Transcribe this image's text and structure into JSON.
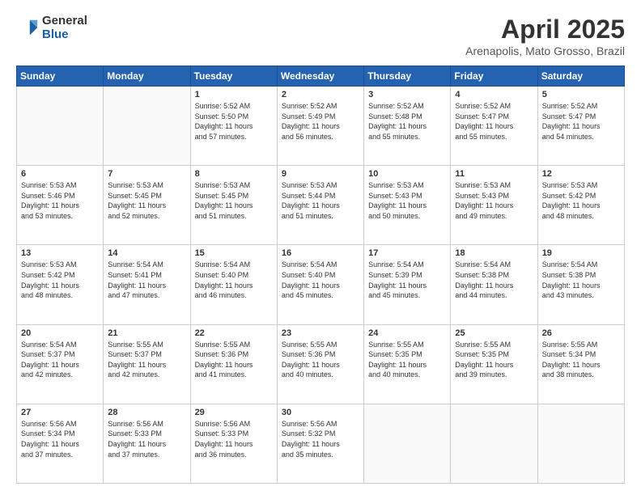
{
  "header": {
    "logo_general": "General",
    "logo_blue": "Blue",
    "title": "April 2025",
    "subtitle": "Arenapolis, Mato Grosso, Brazil"
  },
  "weekdays": [
    "Sunday",
    "Monday",
    "Tuesday",
    "Wednesday",
    "Thursday",
    "Friday",
    "Saturday"
  ],
  "weeks": [
    [
      {
        "day": "",
        "info": ""
      },
      {
        "day": "",
        "info": ""
      },
      {
        "day": "1",
        "info": "Sunrise: 5:52 AM\nSunset: 5:50 PM\nDaylight: 11 hours\nand 57 minutes."
      },
      {
        "day": "2",
        "info": "Sunrise: 5:52 AM\nSunset: 5:49 PM\nDaylight: 11 hours\nand 56 minutes."
      },
      {
        "day": "3",
        "info": "Sunrise: 5:52 AM\nSunset: 5:48 PM\nDaylight: 11 hours\nand 55 minutes."
      },
      {
        "day": "4",
        "info": "Sunrise: 5:52 AM\nSunset: 5:47 PM\nDaylight: 11 hours\nand 55 minutes."
      },
      {
        "day": "5",
        "info": "Sunrise: 5:52 AM\nSunset: 5:47 PM\nDaylight: 11 hours\nand 54 minutes."
      }
    ],
    [
      {
        "day": "6",
        "info": "Sunrise: 5:53 AM\nSunset: 5:46 PM\nDaylight: 11 hours\nand 53 minutes."
      },
      {
        "day": "7",
        "info": "Sunrise: 5:53 AM\nSunset: 5:45 PM\nDaylight: 11 hours\nand 52 minutes."
      },
      {
        "day": "8",
        "info": "Sunrise: 5:53 AM\nSunset: 5:45 PM\nDaylight: 11 hours\nand 51 minutes."
      },
      {
        "day": "9",
        "info": "Sunrise: 5:53 AM\nSunset: 5:44 PM\nDaylight: 11 hours\nand 51 minutes."
      },
      {
        "day": "10",
        "info": "Sunrise: 5:53 AM\nSunset: 5:43 PM\nDaylight: 11 hours\nand 50 minutes."
      },
      {
        "day": "11",
        "info": "Sunrise: 5:53 AM\nSunset: 5:43 PM\nDaylight: 11 hours\nand 49 minutes."
      },
      {
        "day": "12",
        "info": "Sunrise: 5:53 AM\nSunset: 5:42 PM\nDaylight: 11 hours\nand 48 minutes."
      }
    ],
    [
      {
        "day": "13",
        "info": "Sunrise: 5:53 AM\nSunset: 5:42 PM\nDaylight: 11 hours\nand 48 minutes."
      },
      {
        "day": "14",
        "info": "Sunrise: 5:54 AM\nSunset: 5:41 PM\nDaylight: 11 hours\nand 47 minutes."
      },
      {
        "day": "15",
        "info": "Sunrise: 5:54 AM\nSunset: 5:40 PM\nDaylight: 11 hours\nand 46 minutes."
      },
      {
        "day": "16",
        "info": "Sunrise: 5:54 AM\nSunset: 5:40 PM\nDaylight: 11 hours\nand 45 minutes."
      },
      {
        "day": "17",
        "info": "Sunrise: 5:54 AM\nSunset: 5:39 PM\nDaylight: 11 hours\nand 45 minutes."
      },
      {
        "day": "18",
        "info": "Sunrise: 5:54 AM\nSunset: 5:38 PM\nDaylight: 11 hours\nand 44 minutes."
      },
      {
        "day": "19",
        "info": "Sunrise: 5:54 AM\nSunset: 5:38 PM\nDaylight: 11 hours\nand 43 minutes."
      }
    ],
    [
      {
        "day": "20",
        "info": "Sunrise: 5:54 AM\nSunset: 5:37 PM\nDaylight: 11 hours\nand 42 minutes."
      },
      {
        "day": "21",
        "info": "Sunrise: 5:55 AM\nSunset: 5:37 PM\nDaylight: 11 hours\nand 42 minutes."
      },
      {
        "day": "22",
        "info": "Sunrise: 5:55 AM\nSunset: 5:36 PM\nDaylight: 11 hours\nand 41 minutes."
      },
      {
        "day": "23",
        "info": "Sunrise: 5:55 AM\nSunset: 5:36 PM\nDaylight: 11 hours\nand 40 minutes."
      },
      {
        "day": "24",
        "info": "Sunrise: 5:55 AM\nSunset: 5:35 PM\nDaylight: 11 hours\nand 40 minutes."
      },
      {
        "day": "25",
        "info": "Sunrise: 5:55 AM\nSunset: 5:35 PM\nDaylight: 11 hours\nand 39 minutes."
      },
      {
        "day": "26",
        "info": "Sunrise: 5:55 AM\nSunset: 5:34 PM\nDaylight: 11 hours\nand 38 minutes."
      }
    ],
    [
      {
        "day": "27",
        "info": "Sunrise: 5:56 AM\nSunset: 5:34 PM\nDaylight: 11 hours\nand 37 minutes."
      },
      {
        "day": "28",
        "info": "Sunrise: 5:56 AM\nSunset: 5:33 PM\nDaylight: 11 hours\nand 37 minutes."
      },
      {
        "day": "29",
        "info": "Sunrise: 5:56 AM\nSunset: 5:33 PM\nDaylight: 11 hours\nand 36 minutes."
      },
      {
        "day": "30",
        "info": "Sunrise: 5:56 AM\nSunset: 5:32 PM\nDaylight: 11 hours\nand 35 minutes."
      },
      {
        "day": "",
        "info": ""
      },
      {
        "day": "",
        "info": ""
      },
      {
        "day": "",
        "info": ""
      }
    ]
  ]
}
